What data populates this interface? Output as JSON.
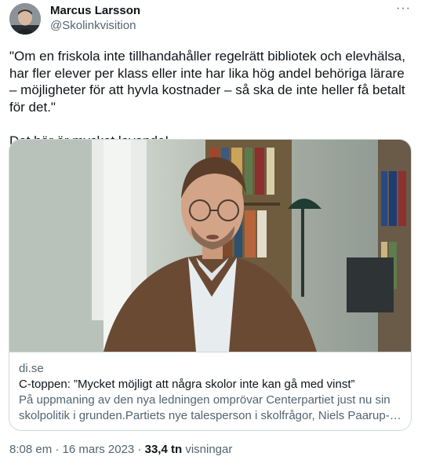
{
  "author": {
    "name": "Marcus Larsson",
    "handle": "@Skolinkvisition"
  },
  "tweet": {
    "paragraph1": "\"Om en friskola inte tillhandahåller regelrätt bibliotek och elevhälsa, har fler elever per klass eller inte har lika hög andel behöriga lärare – möjligheter för att hyvla kostnader – så ska de inte heller få betalt för det.\"",
    "paragraph2": "Det här är mycket lovande!"
  },
  "link_card": {
    "domain": "di.se",
    "title": "C-toppen: ”Mycket möjligt att några skolor inte kan gå med vinst”",
    "description": "På uppmaning av den nya ledningen omprövar Centerpartiet just nu sin skolpolitik i grunden.Partiets nye talesperson i skolfrågor, Niels Paarup-…"
  },
  "meta": {
    "time": "8:08 em",
    "sep1": " · ",
    "date": "16 mars 2023",
    "sep2": " · ",
    "views_count": "33,4 tn",
    "views_label": " visningar"
  },
  "icons": {
    "more": "more-horizontal-icon"
  },
  "colors": {
    "text_primary": "#0f1419",
    "text_secondary": "#536471",
    "border": "#cfd9de"
  }
}
